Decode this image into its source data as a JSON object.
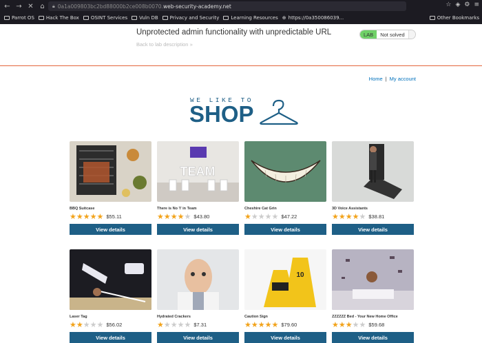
{
  "browser": {
    "url_host_dim": "0a1a009803bc2bd88000b2ce008b0070.",
    "url_domain": "web-security-academy.net",
    "bookmarks": [
      "Parrot OS",
      "Hack The Box",
      "OSINT Services",
      "Vuln DB",
      "Privacy and Security",
      "Learning Resources",
      "https://0a350086039..."
    ],
    "other_bookmarks": "Other Bookmarks"
  },
  "lab": {
    "title": "Unprotected admin functionality with unpredictable URL",
    "back_label": "Back to lab description",
    "badge_lab": "LAB",
    "badge_status": "Not solved"
  },
  "nav": {
    "home": "Home",
    "separator": "|",
    "account": "My account"
  },
  "logo": {
    "small": "WE LIKE TO",
    "big": "SHOP"
  },
  "products": [
    {
      "name": "BBQ Suitcase",
      "stars": 5,
      "price": "$55.11",
      "button": "View details"
    },
    {
      "name": "There is No 'I' in Team",
      "stars": 4,
      "price": "$43.80",
      "button": "View details"
    },
    {
      "name": "Cheshire Cat Grin",
      "stars": 1,
      "price": "$47.22",
      "button": "View details"
    },
    {
      "name": "3D Voice Assistants",
      "stars": 4,
      "price": "$38.81",
      "button": "View details"
    },
    {
      "name": "Laser Tag",
      "stars": 2,
      "price": "$56.02",
      "button": "View details"
    },
    {
      "name": "Hydrated Crackers",
      "stars": 1,
      "price": "$7.31",
      "button": "View details"
    },
    {
      "name": "Caution Sign",
      "stars": 5,
      "price": "$79.60",
      "button": "View details"
    },
    {
      "name": "ZZZZZZ Bed - Your New Home Office",
      "stars": 3,
      "price": "$59.68",
      "button": "View details"
    }
  ]
}
